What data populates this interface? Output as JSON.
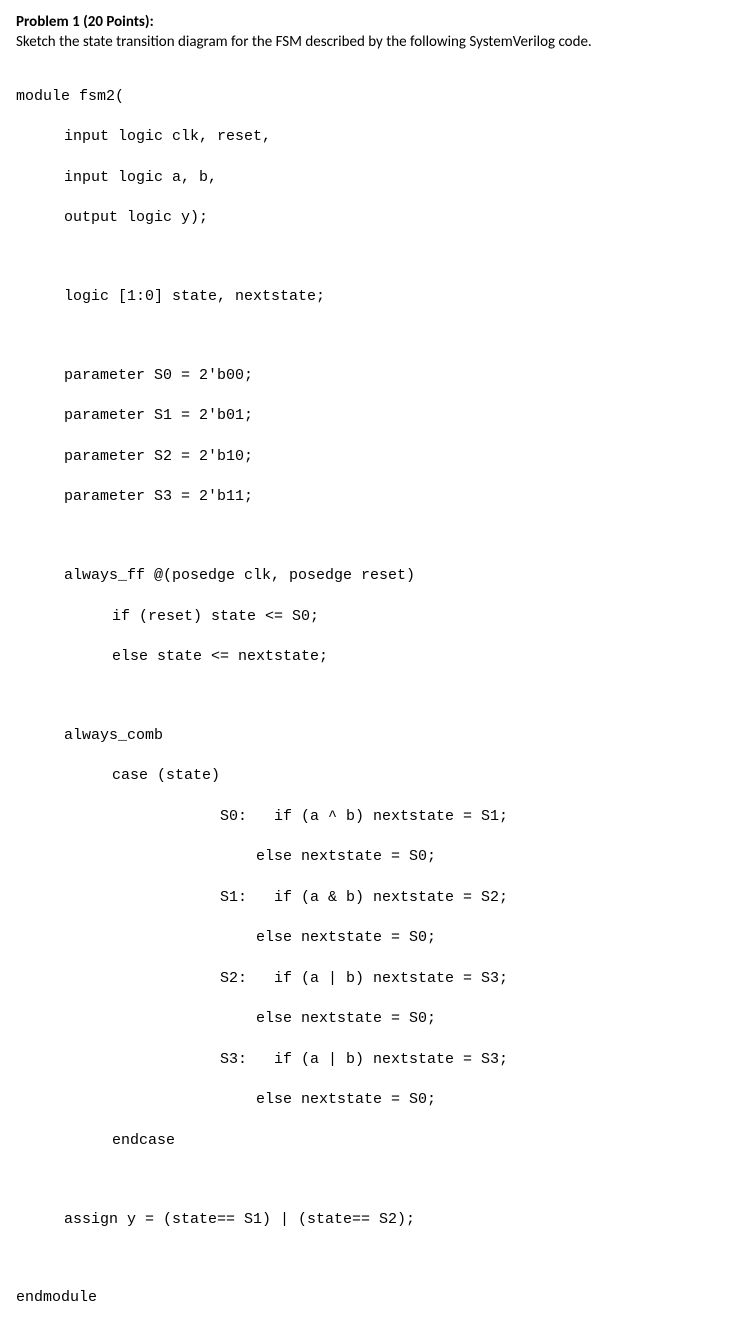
{
  "header": {
    "title": "Problem 1 (20 Points):",
    "prompt": "Sketch the state transition diagram for the FSM described by the following SystemVerilog code."
  },
  "code": {
    "module_line": "module fsm2(",
    "port_clk": "input logic clk, reset,",
    "port_ab": "input logic a, b,",
    "port_y": "output logic y);",
    "state_decl": "logic [1:0] state, nextstate;",
    "param_s0": "parameter S0 = 2'b00;",
    "param_s1": "parameter S1 = 2'b01;",
    "param_s2": "parameter S2 = 2'b10;",
    "param_s3": "parameter S3 = 2'b11;",
    "always_ff": "always_ff @(posedge clk, posedge reset)",
    "ff_if": "if (reset) state <= S0;",
    "ff_else": "else state <= nextstate;",
    "always_comb": "always_comb",
    "case_open": "case (state)",
    "s0_if": "S0:   if (a ^ b) nextstate = S1;",
    "s0_else": "else nextstate = S0;",
    "s1_if": "S1:   if (a & b) nextstate = S2;",
    "s1_else": "else nextstate = S0;",
    "s2_if": "S2:   if (a | b) nextstate = S3;",
    "s2_else": "else nextstate = S0;",
    "s3_if": "S3:   if (a | b) nextstate = S3;",
    "s3_else": "else nextstate = S0;",
    "endcase": "endcase",
    "assign_y": "assign y = (state== S1) | (state== S2);",
    "endmodule": "endmodule"
  }
}
